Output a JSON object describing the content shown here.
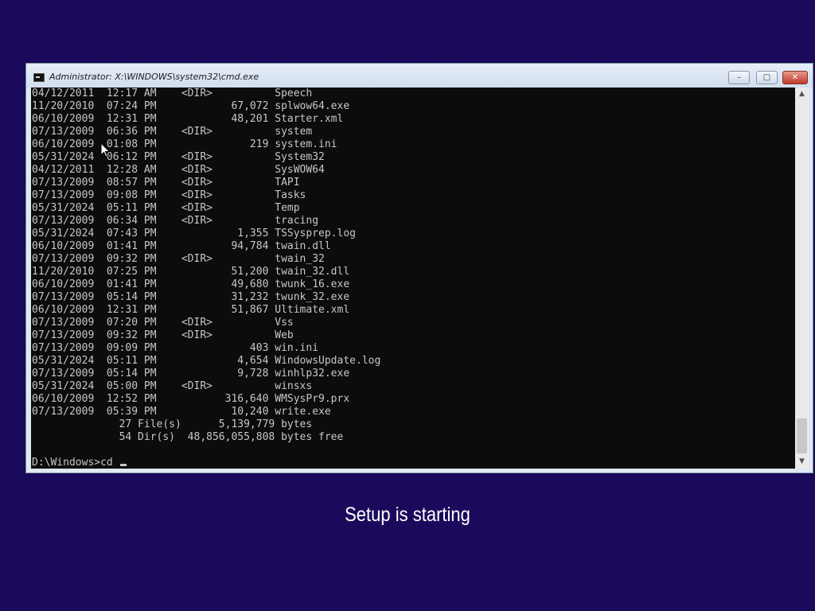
{
  "window": {
    "title": "Administrator: X:\\WINDOWS\\system32\\cmd.exe",
    "icon": "cmd-icon",
    "controls": {
      "minimize": "minimize-icon",
      "maximize": "maximize-icon",
      "close": "close-icon"
    }
  },
  "console": {
    "lines": [
      "04/12/2011  12:17 AM    <DIR>          Speech",
      "11/20/2010  07:24 PM            67,072 splwow64.exe",
      "06/10/2009  12:31 PM            48,201 Starter.xml",
      "07/13/2009  06:36 PM    <DIR>          system",
      "06/10/2009  01:08 PM               219 system.ini",
      "05/31/2024  06:12 PM    <DIR>          System32",
      "04/12/2011  12:28 AM    <DIR>          SysWOW64",
      "07/13/2009  08:57 PM    <DIR>          TAPI",
      "07/13/2009  09:08 PM    <DIR>          Tasks",
      "05/31/2024  05:11 PM    <DIR>          Temp",
      "07/13/2009  06:34 PM    <DIR>          tracing",
      "05/31/2024  07:43 PM             1,355 TSSysprep.log",
      "06/10/2009  01:41 PM            94,784 twain.dll",
      "07/13/2009  09:32 PM    <DIR>          twain_32",
      "11/20/2010  07:25 PM            51,200 twain_32.dll",
      "06/10/2009  01:41 PM            49,680 twunk_16.exe",
      "07/13/2009  05:14 PM            31,232 twunk_32.exe",
      "06/10/2009  12:31 PM            51,867 Ultimate.xml",
      "07/13/2009  07:20 PM    <DIR>          Vss",
      "07/13/2009  09:32 PM    <DIR>          Web",
      "07/13/2009  09:09 PM               403 win.ini",
      "05/31/2024  05:11 PM             4,654 WindowsUpdate.log",
      "07/13/2009  05:14 PM             9,728 winhlp32.exe",
      "05/31/2024  05:00 PM    <DIR>          winsxs",
      "06/10/2009  12:52 PM           316,640 WMSysPr9.prx",
      "07/13/2009  05:39 PM            10,240 write.exe",
      "              27 File(s)      5,139,779 bytes",
      "              54 Dir(s)  48,856,055,808 bytes free"
    ],
    "prompt": "D:\\Windows>cd "
  },
  "scrollbar": {
    "up_icon": "scroll-up-icon",
    "down_icon": "scroll-down-icon"
  },
  "status_text": "Setup is starting",
  "colors": {
    "desktop_background": "#1b0a5c",
    "console_background": "#0c0c0c",
    "console_text": "#c7c7c7",
    "close_button": "#c0392b"
  }
}
